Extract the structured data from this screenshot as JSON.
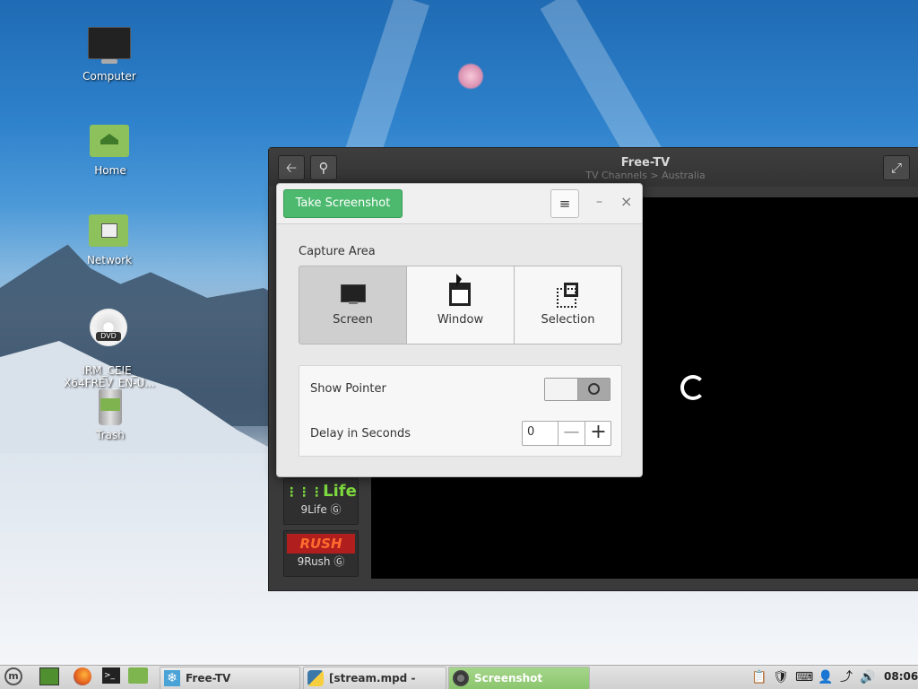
{
  "desktop": {
    "icons": [
      {
        "label": "Computer"
      },
      {
        "label": "Home"
      },
      {
        "label": "Network"
      },
      {
        "label": "IRM_CEIE_\nX64FREV_EN-U..."
      },
      {
        "label": "Trash"
      }
    ]
  },
  "freetv": {
    "title": "Free-TV",
    "subtitle": "TV Channels > Australia",
    "channels": [
      {
        "logo": "Life",
        "label": "9Life Ⓖ"
      },
      {
        "logo": "RUSH",
        "label": "9Rush Ⓖ"
      }
    ]
  },
  "screenshot_dialog": {
    "take_label": "Take Screenshot",
    "menu_glyph": "≡",
    "minimize_glyph": "–",
    "close_glyph": "×",
    "capture_area_label": "Capture Area",
    "areas": [
      {
        "label": "Screen",
        "active": true
      },
      {
        "label": "Window",
        "active": false
      },
      {
        "label": "Selection",
        "active": false
      }
    ],
    "show_pointer_label": "Show Pointer",
    "show_pointer_on": false,
    "delay_label": "Delay in Seconds",
    "delay_value": "0",
    "minus_glyph": "—",
    "plus_glyph": "+"
  },
  "taskbar": {
    "tasks": [
      {
        "label": "Free-TV",
        "active": false
      },
      {
        "label": "[stream.mpd - mpv]",
        "active": false
      },
      {
        "label": "Screenshot",
        "active": true
      }
    ],
    "clock": "08:06"
  }
}
